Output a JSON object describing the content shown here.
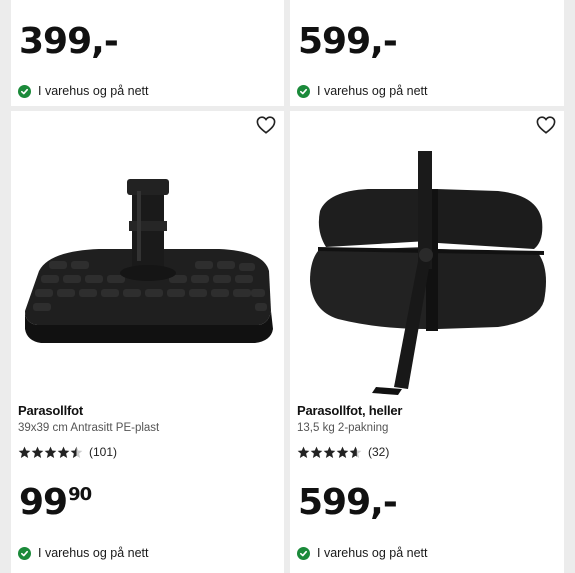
{
  "products": [
    {
      "price_int": "399",
      "price_dec": "",
      "price_suffix": ",-",
      "availability": "I varehus og på nett"
    },
    {
      "price_int": "599",
      "price_dec": "",
      "price_suffix": ",-",
      "availability": "I varehus og på nett"
    },
    {
      "title": "Parasollfot",
      "subtitle": "39x39 cm Antrasitt PE-plast",
      "rating": 4.5,
      "rating_count": "(101)",
      "price_int": "99",
      "price_dec": "90",
      "price_suffix": "",
      "availability": "I varehus og på nett"
    },
    {
      "title": "Parasollfot, heller",
      "subtitle": "13,5 kg 2-pakning",
      "rating": 4.6,
      "rating_count": "(32)",
      "price_int": "599",
      "price_dec": "",
      "price_suffix": ",-",
      "availability": "I varehus og på nett"
    }
  ],
  "colors": {
    "availability_check": "#1b8a3a",
    "background": "#ececec",
    "card": "#ffffff"
  },
  "icons": {
    "favorite": "heart-icon",
    "available": "check-circle-icon",
    "rating": "star-icon"
  }
}
